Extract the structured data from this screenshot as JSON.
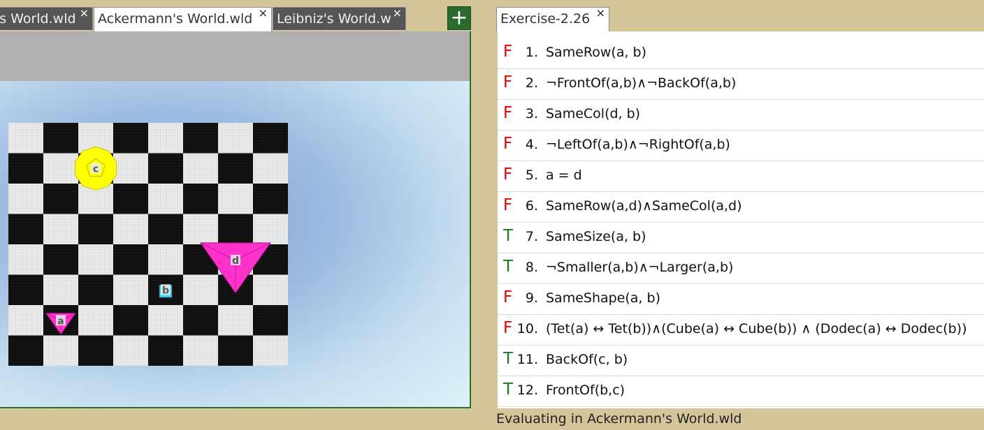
{
  "world_tabs": [
    {
      "label": "Bolzano's World.wld",
      "visible": "'s World.wld",
      "active": false
    },
    {
      "label": "Ackermann's World.wld",
      "active": true
    },
    {
      "label": "Leibniz's World.wld",
      "visible": "Leibniz's World.w",
      "active": false
    }
  ],
  "add_tab_label": "+",
  "close_glyph": "×",
  "sentence_tab": {
    "label": "Exercise-2.26"
  },
  "sentences": [
    {
      "num": "1.",
      "value": "F",
      "text": "SameRow(a, b)"
    },
    {
      "num": "2.",
      "value": "F",
      "text": "¬FrontOf(a,b)∧¬BackOf(a,b)"
    },
    {
      "num": "3.",
      "value": "F",
      "text": "SameCol(d, b)"
    },
    {
      "num": "4.",
      "value": "F",
      "text": "¬LeftOf(a,b)∧¬RightOf(a,b)"
    },
    {
      "num": "5.",
      "value": "F",
      "text": "a = d"
    },
    {
      "num": "6.",
      "value": "F",
      "text": "SameRow(a,d)∧SameCol(a,d)"
    },
    {
      "num": "7.",
      "value": "T",
      "text": "SameSize(a, b)"
    },
    {
      "num": "8.",
      "value": "T",
      "text": "¬Smaller(a,b)∧¬Larger(a,b)"
    },
    {
      "num": "9.",
      "value": "F",
      "text": "SameShape(a, b)"
    },
    {
      "num": "10.",
      "value": "F",
      "text": "(Tet(a) ↔ Tet(b))∧(Cube(a) ↔ Cube(b)) ∧ (Dodec(a) ↔ Dodec(b))"
    },
    {
      "num": "11.",
      "value": "T",
      "text": "BackOf(c, b)"
    },
    {
      "num": "12.",
      "value": "T",
      "text": "FrontOf(b,c)"
    }
  ],
  "status_text": "Evaluating in Ackermann's World.wld",
  "world": {
    "grid_size": 8,
    "objects": [
      {
        "name": "c",
        "shape": "dodec",
        "size": "medium",
        "color": "#ffff00",
        "col": 2,
        "row": 1
      },
      {
        "name": "d",
        "shape": "tet",
        "size": "large",
        "color": "#ff33cc",
        "col": 6,
        "row": 4
      },
      {
        "name": "b",
        "shape": "cube",
        "size": "small",
        "color": "#55ddff",
        "col": 4,
        "row": 5
      },
      {
        "name": "a",
        "shape": "tet",
        "size": "small",
        "color": "#ff33cc",
        "col": 1,
        "row": 6
      }
    ]
  },
  "colors": {
    "true": "#1a7a1a",
    "false": "#e00000",
    "accent": "#2b6b2b"
  }
}
